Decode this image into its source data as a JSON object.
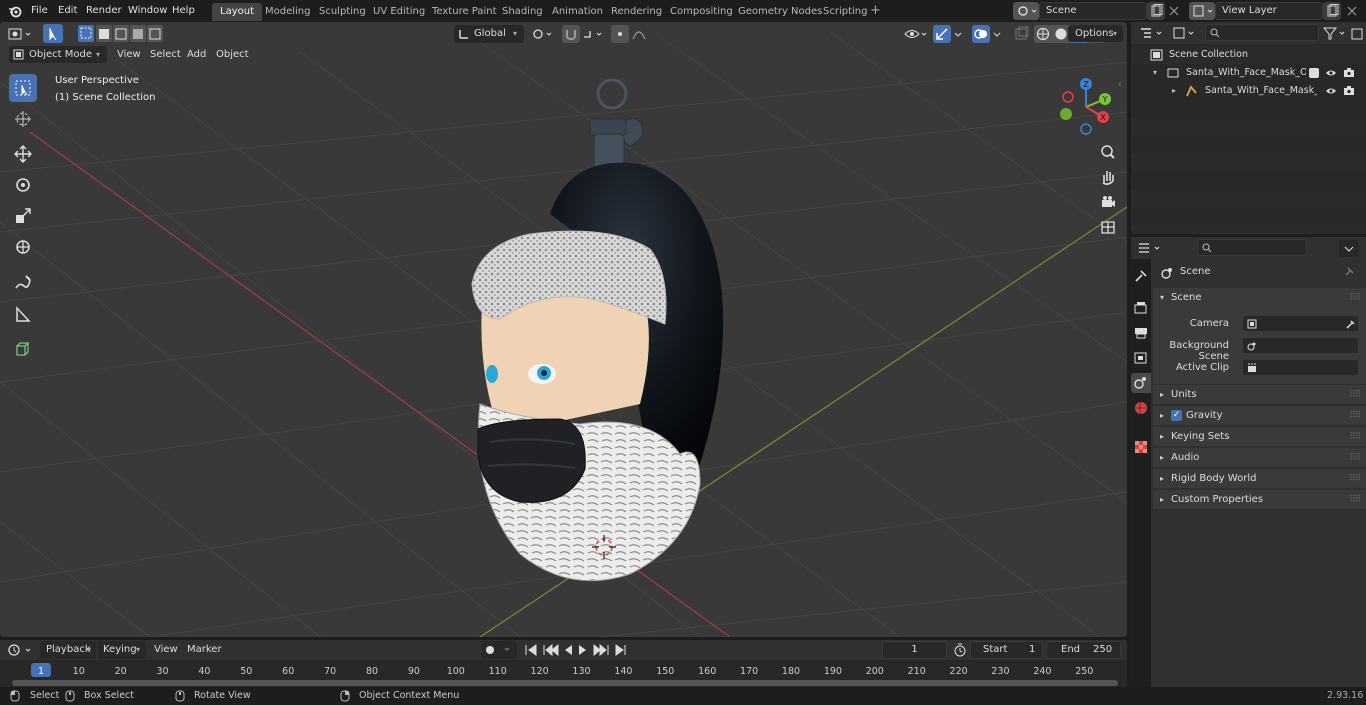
{
  "topbar": {
    "menus": [
      "File",
      "Edit",
      "Render",
      "Window",
      "Help"
    ],
    "workspaces": [
      "Layout",
      "Modeling",
      "Sculpting",
      "UV Editing",
      "Texture Paint",
      "Shading",
      "Animation",
      "Rendering",
      "Compositing",
      "Geometry Nodes",
      "Scripting"
    ],
    "active_workspace": "Layout",
    "scene": "Scene",
    "view_layer": "View Layer"
  },
  "viewport_header": {
    "mode": "Object Mode",
    "menus": [
      "View",
      "Select",
      "Add",
      "Object"
    ],
    "transform_orientation": "Global",
    "options_label": "Options"
  },
  "viewport": {
    "perspective": "User Perspective",
    "collection": "(1) Scene Collection",
    "gizmo_axes": {
      "x": "X",
      "y": "Y",
      "z": "Z"
    }
  },
  "outliner": {
    "root": "Scene Collection",
    "items": [
      {
        "label": "Santa_With_Face_Mask_Orna"
      },
      {
        "label": "Santa_With_Face_Mask_("
      }
    ]
  },
  "properties": {
    "context": "Scene",
    "section": "Scene",
    "fields": [
      {
        "label": "Camera",
        "value": ""
      },
      {
        "label": "Background Scene",
        "value": ""
      },
      {
        "label": "Active Clip",
        "value": ""
      }
    ],
    "panels": [
      "Units",
      "Gravity",
      "Keying Sets",
      "Audio",
      "Rigid Body World",
      "Custom Properties"
    ],
    "gravity_checked": true
  },
  "timeline": {
    "menus": [
      "Playback",
      "Keying",
      "View",
      "Marker"
    ],
    "current_frame": "1",
    "start_label": "Start",
    "start": "1",
    "end_label": "End",
    "end": "250",
    "ruler": [
      "1",
      "10",
      "20",
      "30",
      "40",
      "50",
      "60",
      "70",
      "80",
      "90",
      "100",
      "110",
      "120",
      "130",
      "140",
      "150",
      "160",
      "170",
      "180",
      "190",
      "200",
      "210",
      "220",
      "230",
      "240",
      "250"
    ]
  },
  "statusbar": {
    "select": "Select",
    "box_select": "Box Select",
    "rotate": "Rotate View",
    "context_menu": "Object Context Menu",
    "version": "2.93.16"
  },
  "colors": {
    "accent": "#4772b3",
    "x_axis": "#e5404a",
    "y_axis": "#7ac72e",
    "z_axis": "#3b82d6",
    "viewport_bg": "#393939"
  }
}
